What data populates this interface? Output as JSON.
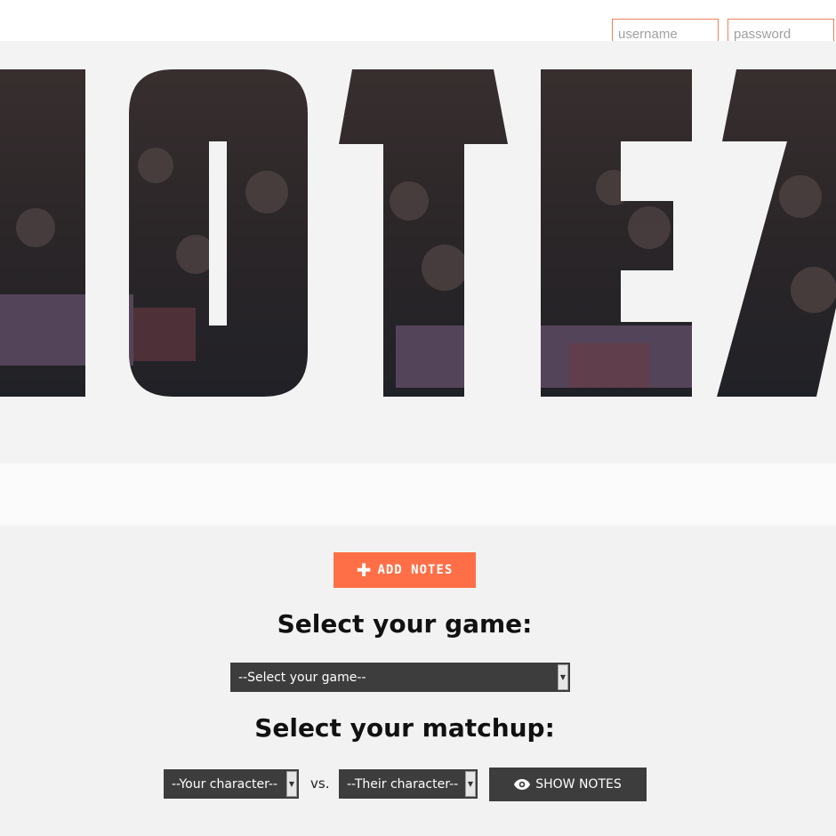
{
  "login": {
    "username_placeholder": "username",
    "password_placeholder": "password"
  },
  "hero": {
    "logo_text": "NOTEZ",
    "accent_color": "#ff6f47"
  },
  "actions": {
    "add_notes_label": "ADD NOTES",
    "add_icon": "plus-icon"
  },
  "game_section": {
    "heading": "Select your game:",
    "game_select_value": "--Select your game--"
  },
  "matchup_section": {
    "heading": "Select your matchup:",
    "your_character_value": "--Your character--",
    "versus_label": "vs.",
    "their_character_value": "--Their character--",
    "show_notes_label": "SHOW NOTES",
    "show_icon": "eye-icon"
  }
}
